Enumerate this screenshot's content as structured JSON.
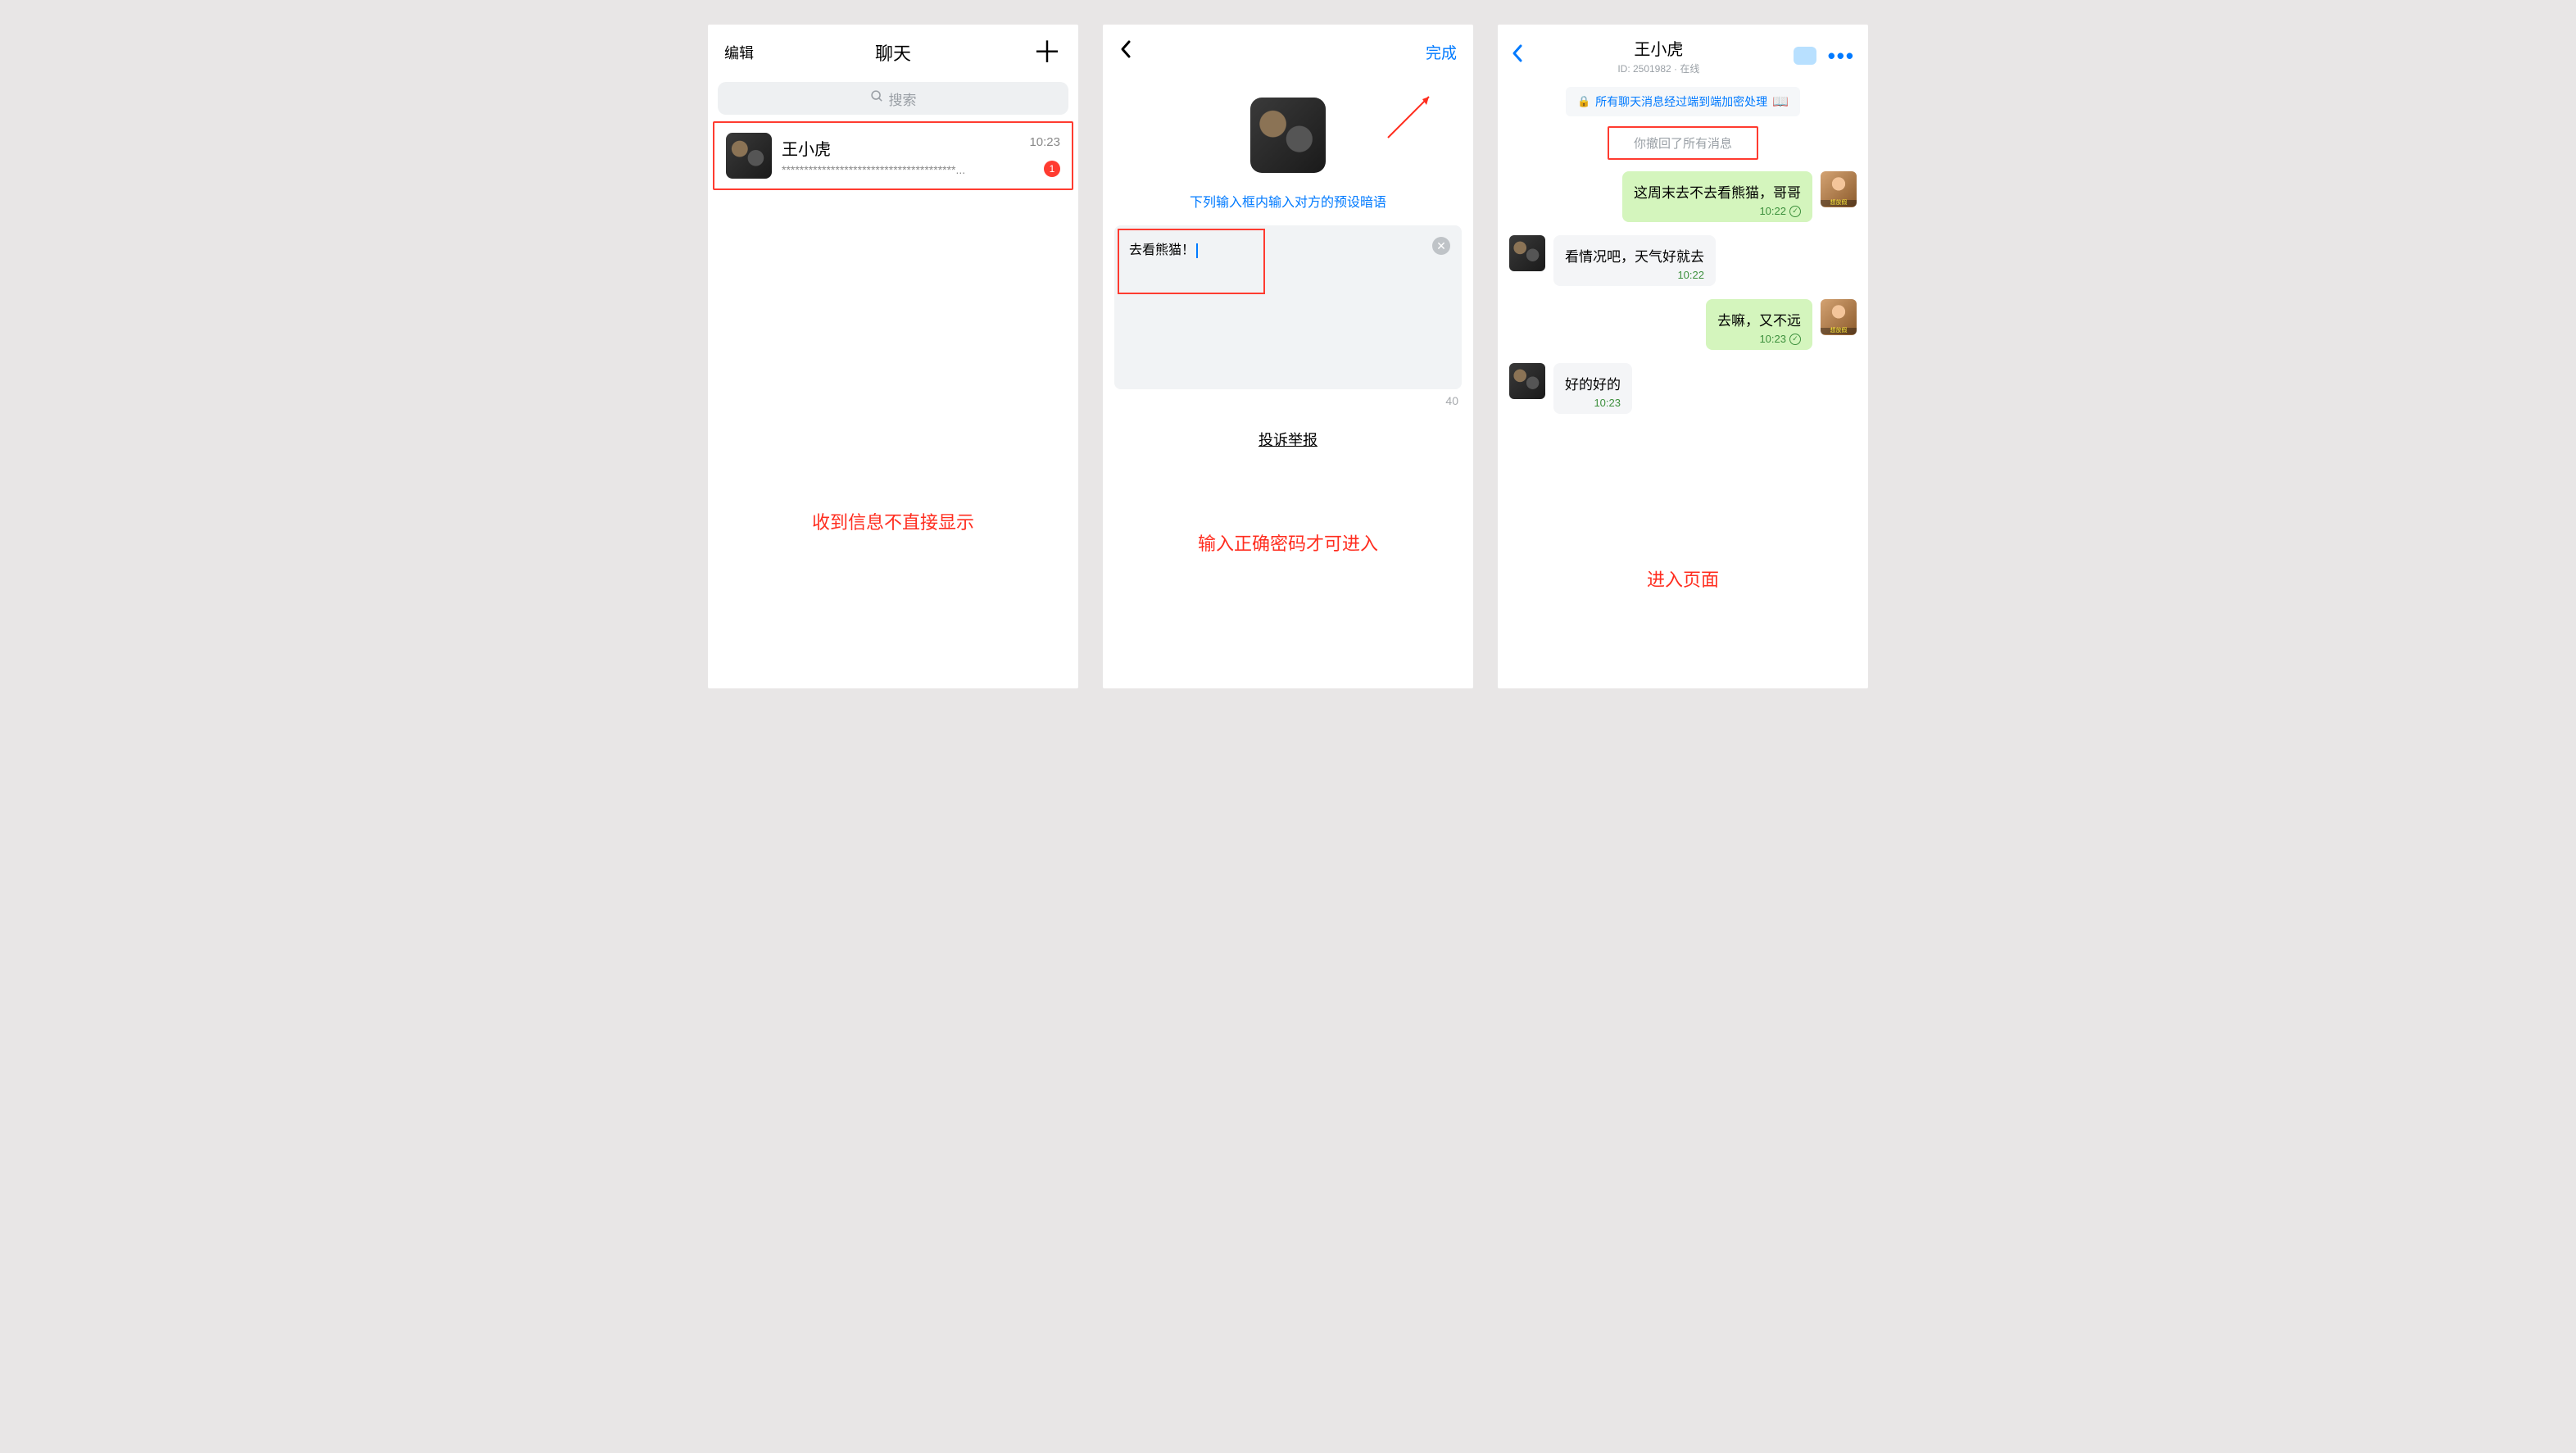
{
  "screen1": {
    "edit_label": "编辑",
    "title": "聊天",
    "search_placeholder": "搜索",
    "chat": {
      "name": "王小虎",
      "preview": "***************************************...",
      "time": "10:23",
      "badge": "1"
    },
    "caption": "收到信息不直接显示"
  },
  "screen2": {
    "done_label": "完成",
    "hint": "下列输入框内输入对方的预设暗语",
    "input_value": "去看熊猫！",
    "char_count": "40",
    "report_label": "投诉举报",
    "caption": "输入正确密码才可进入"
  },
  "screen3": {
    "name": "王小虎",
    "id_line": "ID: 2501982 · 在线",
    "encrypt_notice": "所有聊天消息经过端到端加密处理",
    "recall_notice": "你撤回了所有消息",
    "messages": [
      {
        "side": "sent",
        "text": "这周末去不去看熊猫，哥哥",
        "time": "10:22",
        "check": true,
        "avatar": "kid"
      },
      {
        "side": "recv",
        "text": "看情况吧，天气好就去",
        "time": "10:22",
        "check": false,
        "avatar": "bike"
      },
      {
        "side": "sent",
        "text": "去嘛，又不远",
        "time": "10:23",
        "check": true,
        "avatar": "kid"
      },
      {
        "side": "recv",
        "text": "好的好的",
        "time": "10:23",
        "check": false,
        "avatar": "bike"
      }
    ],
    "caption": "进入页面"
  }
}
